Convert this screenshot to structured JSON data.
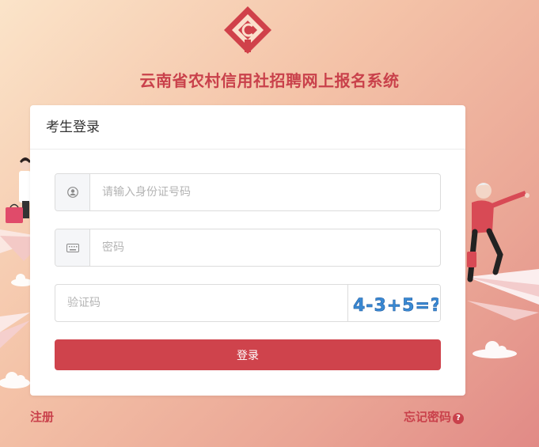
{
  "site": {
    "title": "云南省农村信用社招聘网上报名系统",
    "logo_icon": "rural-credit-union-logo",
    "brand_color": "#c9414b"
  },
  "login": {
    "header": "考生登录",
    "id_field": {
      "placeholder": "请输入身份证号码",
      "value": "",
      "icon": "user-icon"
    },
    "password_field": {
      "placeholder": "密码",
      "value": "",
      "icon": "keyboard-icon"
    },
    "captcha_field": {
      "placeholder": "验证码",
      "value": ""
    },
    "captcha_image_text": "4-3+5=?",
    "submit_label": "登录",
    "button_color": "#cf434c"
  },
  "links": {
    "register": "注册",
    "forgot_password": "忘记密码"
  }
}
